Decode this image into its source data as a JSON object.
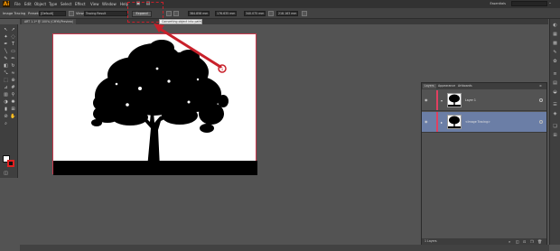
{
  "app": {
    "logo": "Ai"
  },
  "menu": {
    "items": [
      "File",
      "Edit",
      "Object",
      "Type",
      "Select",
      "Effect",
      "View",
      "Window",
      "Help"
    ]
  },
  "workspace": {
    "name": "Essentials"
  },
  "controlbar": {
    "mode_label": "Image Tracing",
    "preset_label": "Preset:",
    "preset_value": "[Default]",
    "view_label": "View:",
    "view_value": "Tracing Result",
    "expand_label": "Expand",
    "x_value": "384.858 mm",
    "y_value": "176.635 mm",
    "w_value": "340.075 mm",
    "h_value": "218.163 mm"
  },
  "tooltip": {
    "text": "Converting object into paths"
  },
  "document": {
    "tab_label": "ART 1.1* @ 100% (CMYK/Preview)"
  },
  "layers_panel": {
    "tabs": [
      "Layers",
      "Appearance",
      "Artboards"
    ],
    "rows": [
      {
        "name": "Layer 1",
        "selected": false
      },
      {
        "name": "<Image Tracing>",
        "selected": true
      }
    ],
    "footer_count": "1 Layers"
  },
  "colors": {
    "accent": "#c8202a",
    "selected_row": "#6b7ea6",
    "layer_color": "#e04060"
  },
  "icons": [
    "selection-icon",
    "direct-selection-icon",
    "magic-wand-icon",
    "lasso-icon",
    "pen-icon",
    "type-icon",
    "line-icon",
    "rectangle-icon",
    "paintbrush-icon",
    "pencil-icon",
    "eraser-icon",
    "rotate-icon",
    "scale-icon",
    "warp-icon",
    "free-transform-icon",
    "shape-builder-icon",
    "perspective-icon",
    "mesh-icon",
    "gradient-icon",
    "eyedropper-icon",
    "blend-icon",
    "symbol-sprayer-icon",
    "column-graph-icon",
    "artboard-icon",
    "slice-icon",
    "hand-icon",
    "zoom-icon"
  ]
}
